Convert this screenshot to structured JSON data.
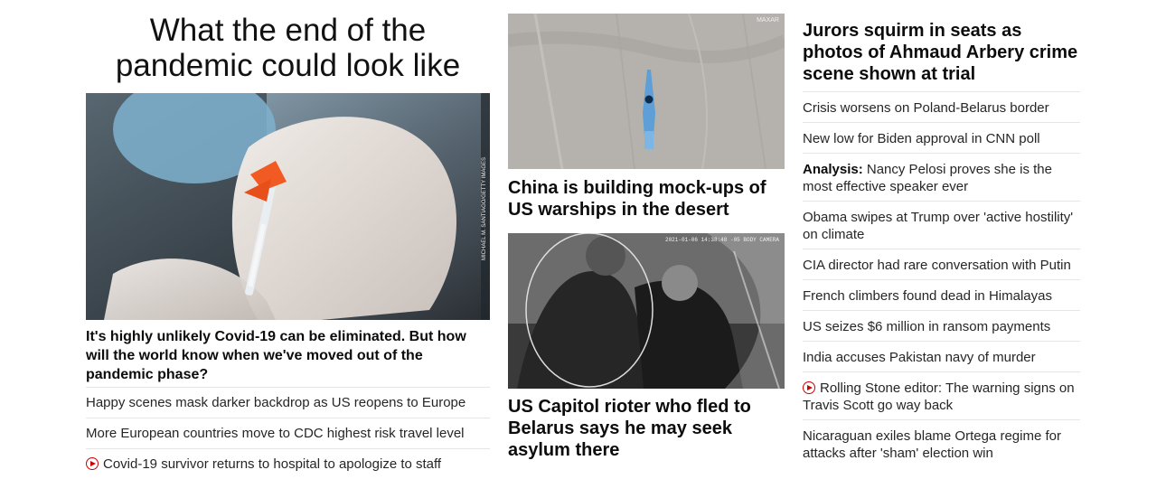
{
  "left": {
    "headline": "What the end of the pandemic could look like",
    "photo_credit": "MICHAEL M. SANTIAGO/GETTY IMAGES",
    "caption": "It's highly unlikely Covid-19 can be eliminated. But how will the world know when we've moved out of the pandemic phase?",
    "links": [
      {
        "text": "Happy scenes mask darker backdrop as US reopens to Europe",
        "video": false
      },
      {
        "text": "More European countries move to CDC highest risk travel level",
        "video": false
      },
      {
        "text": "Covid-19 survivor returns to hospital to apologize to staff",
        "video": true,
        "icon": "play-icon"
      }
    ]
  },
  "middle": {
    "story1": {
      "headline": "China is building mock-ups of US warships in the desert",
      "image_watermark": "MAXAR"
    },
    "story2": {
      "headline": "US Capitol rioter who fled to Belarus says he may seek asylum there",
      "image_timestamp": "2021-01-06 14:38:48 -05 BODY CAMERA"
    }
  },
  "right": {
    "headline": "Jurors squirm in seats as photos of Ahmaud Arbery crime scene shown at trial",
    "links": [
      {
        "kicker": "",
        "text": "Crisis worsens on Poland-Belarus border",
        "video": false
      },
      {
        "kicker": "",
        "text": "New low for Biden approval in CNN poll",
        "video": false
      },
      {
        "kicker": "Analysis:",
        "text": "Nancy Pelosi proves she is the most effective speaker ever",
        "video": false
      },
      {
        "kicker": "",
        "text": "Obama swipes at Trump over 'active hostility' on climate",
        "video": false
      },
      {
        "kicker": "",
        "text": "CIA director had rare conversation with Putin",
        "video": false
      },
      {
        "kicker": "",
        "text": "French climbers found dead in Himalayas",
        "video": false
      },
      {
        "kicker": "",
        "text": "US seizes $6 million in ransom payments",
        "video": false
      },
      {
        "kicker": "",
        "text": "India accuses Pakistan navy of murder",
        "video": false
      },
      {
        "kicker": "",
        "text": "Rolling Stone editor: The warning signs on Travis Scott go way back",
        "video": true,
        "icon": "play-icon"
      },
      {
        "kicker": "",
        "text": "Nicaraguan exiles blame Ortega regime for attacks after 'sham' election win",
        "video": false
      }
    ]
  },
  "colors": {
    "video_icon": "#cc0000",
    "divider": "#e6e6e6",
    "text": "#0c0c0c"
  }
}
